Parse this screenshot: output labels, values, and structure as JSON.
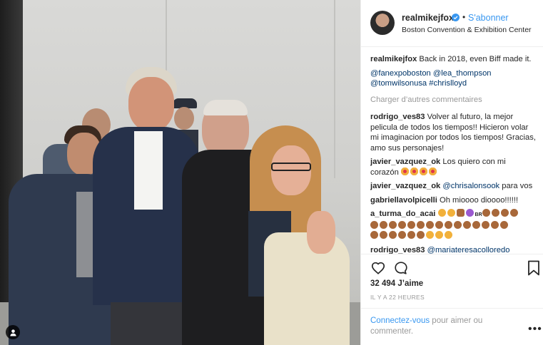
{
  "post": {
    "username": "realmikejfox",
    "follow_label": "S'abonner",
    "dot": "•",
    "location": "Boston Convention & Exhibition Center",
    "caption": "Back in 2018, even Biff made it.",
    "mentions": [
      "@fanexpoboston",
      "@lea_thompson",
      "@tomwilsonusa",
      "#chrislloyd"
    ],
    "load_more": "Charger d’autres commentaires",
    "likes_count": "32 494",
    "likes_label": "J’aime",
    "time": "IL Y A 22 HEURES",
    "login_link": "Connectez-vous",
    "login_rest": " pour aimer ou commenter.",
    "more_label": "•••"
  },
  "comments": [
    {
      "user": "rodrigo_ves83",
      "text": "Volver al futuro, la mejor pelicula de todos los tiempos!! Hicieron volar mi imaginacion por todos los tiempos! Gracias, amo sus personajes!"
    },
    {
      "user": "javier_vazquez_ok",
      "text": "Los quiero con mi corazón"
    },
    {
      "user": "javier_vazquez_ok",
      "text": "para vos",
      "mention": "@chrisalonsook"
    },
    {
      "user": "gabriellavolpicelli",
      "text": "Oh mioooo dioooo!!!!!!"
    },
    {
      "user": "a_turma_do_acai",
      "text": "BR"
    },
    {
      "user": "rodrigo_ves83",
      "text": "",
      "mention": "@mariateresacolloredo"
    }
  ],
  "colors": {
    "accent": "#3897f0",
    "link": "#003569",
    "muted": "#999999",
    "text": "#262626",
    "emoji_face": "#f2b13b",
    "emoji_heart": "#e0354b",
    "emoji_hand": "#a8683a",
    "emoji_purple": "#9b59d0"
  },
  "icons": [
    "verified-badge-icon",
    "heart-icon",
    "comment-icon",
    "bookmark-icon",
    "user-tag-icon"
  ]
}
